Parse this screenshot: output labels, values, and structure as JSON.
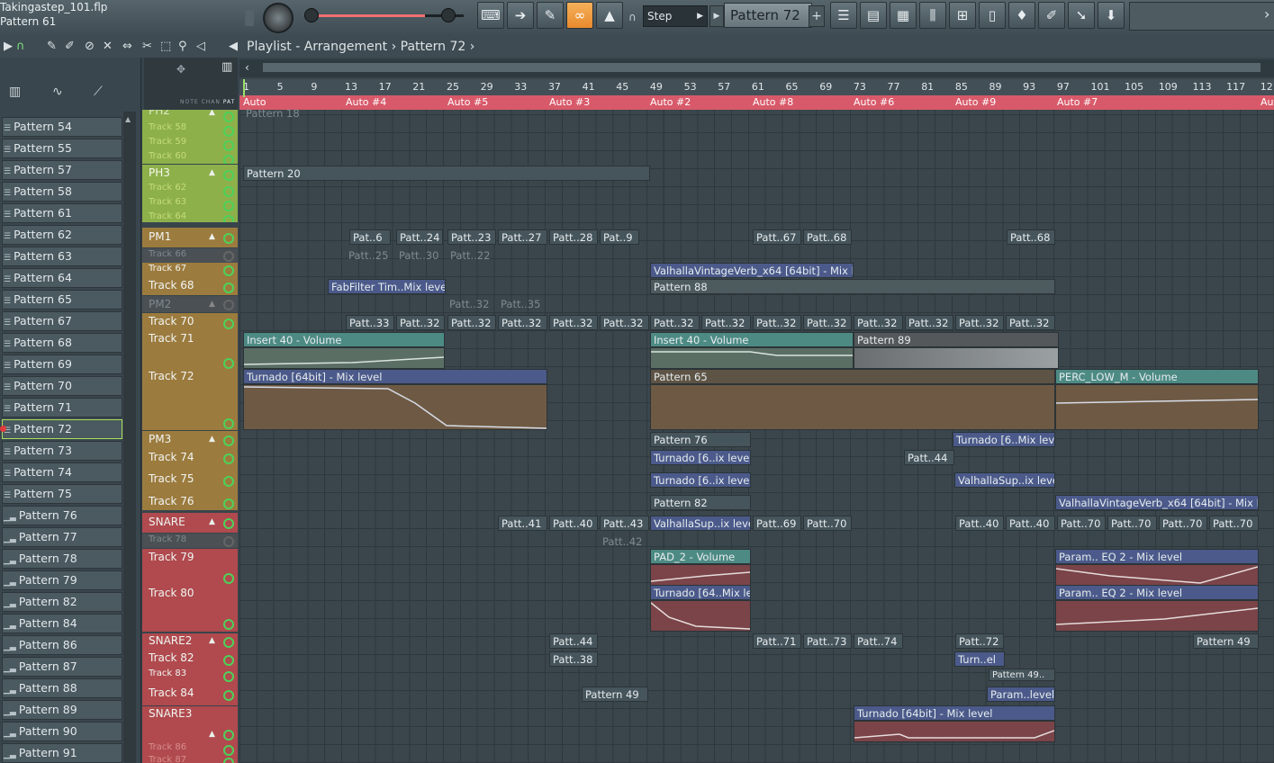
{
  "window": {
    "filename": "Takingastep_101.flp",
    "current_pattern": "Pattern 61"
  },
  "toolbar": {
    "snap": "Step",
    "pattern_selector": "Pattern 72",
    "plus": "+"
  },
  "playlist": {
    "title": "Playlist - Arrangement",
    "separator": "›",
    "pattern": "Pattern 72",
    "arrow": "›"
  },
  "left_header": {
    "icons": [
      "piano-roll",
      "waveform",
      "automation"
    ]
  },
  "patterns": [
    "Pattern 54",
    "Pattern 55",
    "Pattern 57",
    "Pattern 58",
    "Pattern 61",
    "Pattern 62",
    "Pattern 63",
    "Pattern 64",
    "Pattern 65",
    "Pattern 67",
    "Pattern 68",
    "Pattern 69",
    "Pattern 70",
    "Pattern 71",
    "Pattern 72",
    "Pattern 73",
    "Pattern 74",
    "Pattern 75",
    "Pattern 76",
    "Pattern 77",
    "Pattern 78",
    "Pattern 79",
    "Pattern 82",
    "Pattern 84",
    "Pattern 86",
    "Pattern 87",
    "Pattern 88",
    "Pattern 89",
    "Pattern 90",
    "Pattern 91"
  ],
  "header_labels": {
    "note": "NOTE",
    "chan": "CHAN",
    "pat": "PAT"
  },
  "ruler": [
    "1",
    "5",
    "9",
    "13",
    "17",
    "21",
    "25",
    "29",
    "33",
    "37",
    "41",
    "45",
    "49",
    "53",
    "57",
    "61",
    "65",
    "69",
    "73",
    "77",
    "81",
    "85",
    "89",
    "93",
    "97",
    "101",
    "105",
    "109",
    "113",
    "117",
    "121"
  ],
  "auto_labels": [
    "Auto",
    "Auto #4",
    "Auto #5",
    "Auto #3",
    "Auto #2",
    "Auto #8",
    "Auto #6",
    "Auto #9",
    "Auto #7",
    "Auto"
  ],
  "tracks": {
    "t58": "Track 58",
    "t59": "Track 59",
    "t60": "Track 60",
    "ph3": "PH3",
    "t62": "Track 62",
    "t63": "Track 63",
    "t64": "Track 64",
    "pm1": "PM1",
    "t66": "Track 66",
    "t67": "Track 67",
    "t68": "Track 68",
    "pm2": "PM2",
    "t70": "Track 70",
    "t71": "Track 71",
    "t72": "Track 72",
    "pm3": "PM3",
    "t74": "Track 74",
    "t75": "Track 75",
    "t76": "Track 76",
    "snare": "SNARE",
    "t78": "Track 78",
    "t79": "Track 79",
    "t80": "Track 80",
    "snare2": "SNARE2",
    "t82": "Track 82",
    "t83": "Track 83",
    "t84": "Track 84",
    "snare3": "SNARE3",
    "t86": "Track 86",
    "t87": "Track 87",
    "ph2": "PH2"
  },
  "clips": {
    "c_p18": "Pattern 18",
    "c_p20": "Pattern 20",
    "c_pm1_a": "Pat..6",
    "c_pm1_b": "Patt..24",
    "c_pm1_c": "Patt..23",
    "c_pm1_d": "Patt..27",
    "c_pm1_e": "Patt..28",
    "c_pm1_f": "Pat..9",
    "c_pm1_g": "Patt..67",
    "c_pm1_h": "Patt..68",
    "c_pm1_i": "Patt..68",
    "c_t66_a": "Patt..25",
    "c_t66_b": "Patt..30",
    "c_t66_c": "Patt..22",
    "c_valh": "ValhallaVintageVerb_x64 [64bit] - Mix level",
    "c_fab": "FabFilter Tim..Mix level",
    "c_p88": "Pattern 88",
    "c_pm2_a": "Patt..32",
    "c_pm2_b": "Patt..35",
    "c_t70": "Patt..33",
    "c_t70b": "Patt..32",
    "c_t70c": "Patt..32",
    "c_t70d": "Patt..32",
    "c_t70e": "Patt..32",
    "c_t70f": "Patt..32",
    "c_t70g": "Patt..32",
    "c_t70h": "Patt..32",
    "c_t70i": "Patt..32",
    "c_t70j": "Patt..32",
    "c_t70k": "Patt..32",
    "c_t70l": "Patt..32",
    "c_t70m": "Patt..32",
    "c_ins40": "Insert 40 - Volume",
    "c_ins40b": "Insert 40 - Volume",
    "c_p89": "Pattern 89",
    "c_turnado": "Turnado [64bit] - Mix level",
    "c_p65": "Pattern 65",
    "c_perc": "PERC_LOW_M - Volume",
    "c_p76": "Pattern 76",
    "c_turn6": "Turnado [6..Mix level",
    "c_t74a": "Turnado [6..ix level",
    "c_t74b": "Patt..44",
    "c_t75a": "Turnado [6..ix level",
    "c_t75b": "ValhallaSup..ix level",
    "c_p82": "Pattern 82",
    "c_valh2": "ValhallaVintageVerb_x64 [64bit] - Mix level",
    "c_sn_a": "Patt..41",
    "c_sn_b": "Patt..40",
    "c_sn_c": "Patt..43",
    "c_sn_d": "ValhallaSup..ix level",
    "c_sn_e": "Patt..69",
    "c_sn_f": "Patt..70",
    "c_sn_g": "Patt..40",
    "c_sn_h": "Patt..40",
    "c_sn_i": "Patt..70",
    "c_sn_j": "Patt..70",
    "c_sn_k": "Patt..70",
    "c_sn_l": "Patt..70",
    "c_t78": "Patt..42",
    "c_pad": "PAD_2 - Volume",
    "c_peq1": "Param.. EQ 2 - Mix level",
    "c_turn64": "Turnado [64..Mix level",
    "c_peq2": "Param.. EQ 2 - Mix level",
    "c_s2_a": "Patt..44",
    "c_s2_b": "Patt..71",
    "c_s2_c": "Patt..73",
    "c_s2_d": "Patt..74",
    "c_s2_e": "Patt..72",
    "c_s2_f": "Pattern 49",
    "c_t82a": "Patt..38",
    "c_t82b": "Turn..el",
    "c_t83": "Pattern 49..",
    "c_t84a": "Pattern 49",
    "c_t84b": "Param..level",
    "c_s3": "Turnado [64bit] - Mix level"
  },
  "colors": {
    "green": "#8db04a",
    "orange": "#9c7b3e",
    "red": "#b04a4e",
    "auto": "#d85a6a",
    "accent": "#e98a2e"
  }
}
